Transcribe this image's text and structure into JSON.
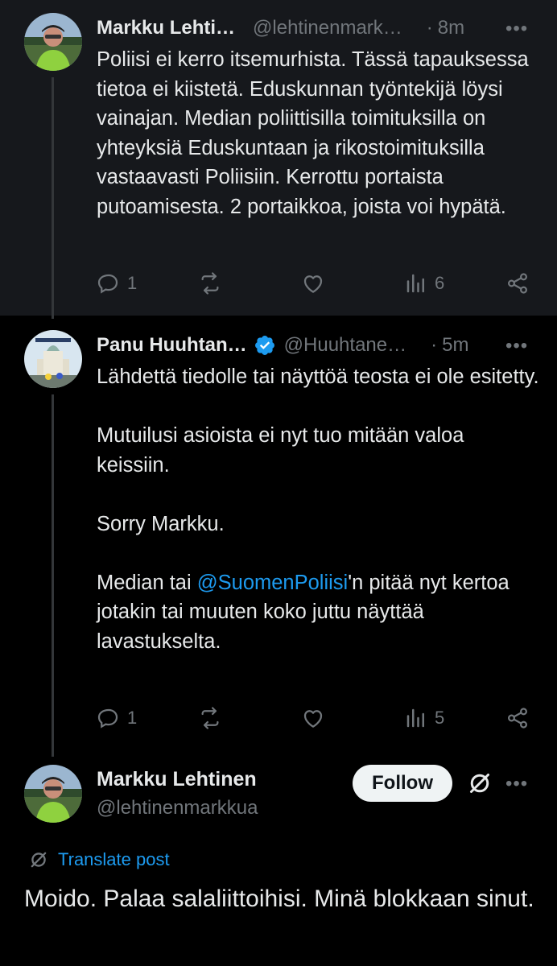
{
  "tweets": [
    {
      "author": "Markku Lehti…",
      "handle": "@lehtinenmark…",
      "dot": "·",
      "time": "8m",
      "more": "•••",
      "text": "Poliisi ei kerro itsemurhista. Tässä tapauksessa tietoa ei kiistetä. Eduskunnan työntekijä löysi vainajan. Median poliittisilla toimituksilla on yhteyksiä Eduskuntaan ja rikostoimituksilla vastaavasti Poliisiin. Kerrottu portaista putoamisesta. 2 portaikkoa, joista voi hypätä.",
      "replies": "1",
      "views": "6"
    },
    {
      "author": "Panu Huuhtan…",
      "verified": true,
      "handle": "@Huuhtane…",
      "dot": "·",
      "time": "5m",
      "more": "•••",
      "paragraphs": [
        "Lähdettä tiedolle tai näyttöä teosta ei ole esitetty.",
        "Mutuilusi asioista ei nyt tuo mitään valoa keissiin.",
        "Sorry Markku."
      ],
      "last_prefix": "Median tai ",
      "mention": "@SuomenPoliisi",
      "last_suffix": "'n pitää nyt kertoa jotakin tai muuten koko juttu näyttää lavastukselta.",
      "replies": "1",
      "views": "5"
    }
  ],
  "main_post": {
    "author": "Markku Lehtinen",
    "handle": "@lehtinenmarkkua",
    "follow_label": "Follow",
    "more": "•••",
    "translate_label": "Translate post",
    "text": "Moido. Palaa salaliittoihisi. Minä blokkaan sinut."
  },
  "colors": {
    "background": "#000000",
    "highlight_bg": "#16181c",
    "text": "#e7e9ea",
    "muted": "#71767b",
    "link": "#1d9bf0",
    "verified": "#1d9bf0"
  },
  "icons": [
    "reply-icon",
    "retweet-icon",
    "like-icon",
    "views-icon",
    "share-icon",
    "grok-icon",
    "translate-icon",
    "verified-badge-icon",
    "more-icon"
  ]
}
